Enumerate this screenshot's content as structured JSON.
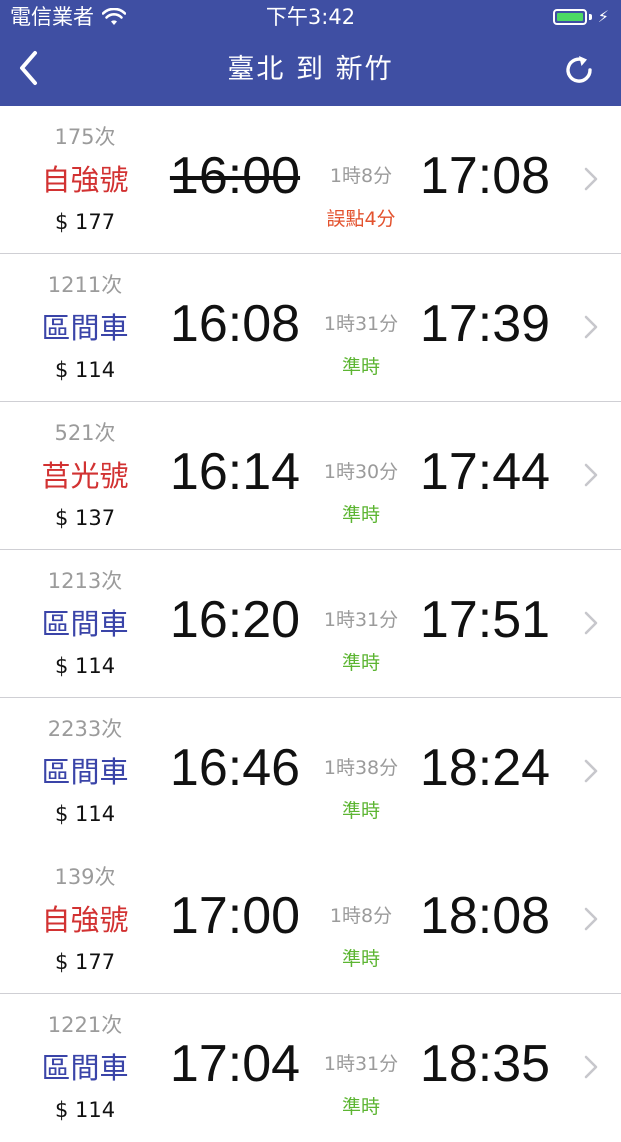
{
  "status_bar": {
    "carrier": "電信業者",
    "time": "下午3:42"
  },
  "nav": {
    "title": "臺北 到 新竹"
  },
  "colors": {
    "header_bg": "#3f4fa3",
    "express": "#d23232",
    "local": "#3a44a8",
    "ontime": "#5cb532",
    "delayed": "#e3522e",
    "muted": "#9b9b9b"
  },
  "trains": [
    {
      "number": "175次",
      "type": "自強號",
      "price": "$ 177",
      "depart": "16:00",
      "duration": "1時8分",
      "arrive": "17:08",
      "status": "誤點4分"
    },
    {
      "number": "1211次",
      "type": "區間車",
      "price": "$ 114",
      "depart": "16:08",
      "duration": "1時31分",
      "arrive": "17:39",
      "status": "準時"
    },
    {
      "number": "521次",
      "type": "莒光號",
      "price": "$ 137",
      "depart": "16:14",
      "duration": "1時30分",
      "arrive": "17:44",
      "status": "準時"
    },
    {
      "number": "1213次",
      "type": "區間車",
      "price": "$ 114",
      "depart": "16:20",
      "duration": "1時31分",
      "arrive": "17:51",
      "status": "準時"
    },
    {
      "number": "2233次",
      "type": "區間車",
      "price": "$ 114",
      "depart": "16:46",
      "duration": "1時38分",
      "arrive": "18:24",
      "status": "準時"
    },
    {
      "number": "139次",
      "type": "自強號",
      "price": "$ 177",
      "depart": "17:00",
      "duration": "1時8分",
      "arrive": "18:08",
      "status": "準時"
    },
    {
      "number": "1221次",
      "type": "區間車",
      "price": "$ 114",
      "depart": "17:04",
      "duration": "1時31分",
      "arrive": "18:35",
      "status": "準時"
    }
  ]
}
